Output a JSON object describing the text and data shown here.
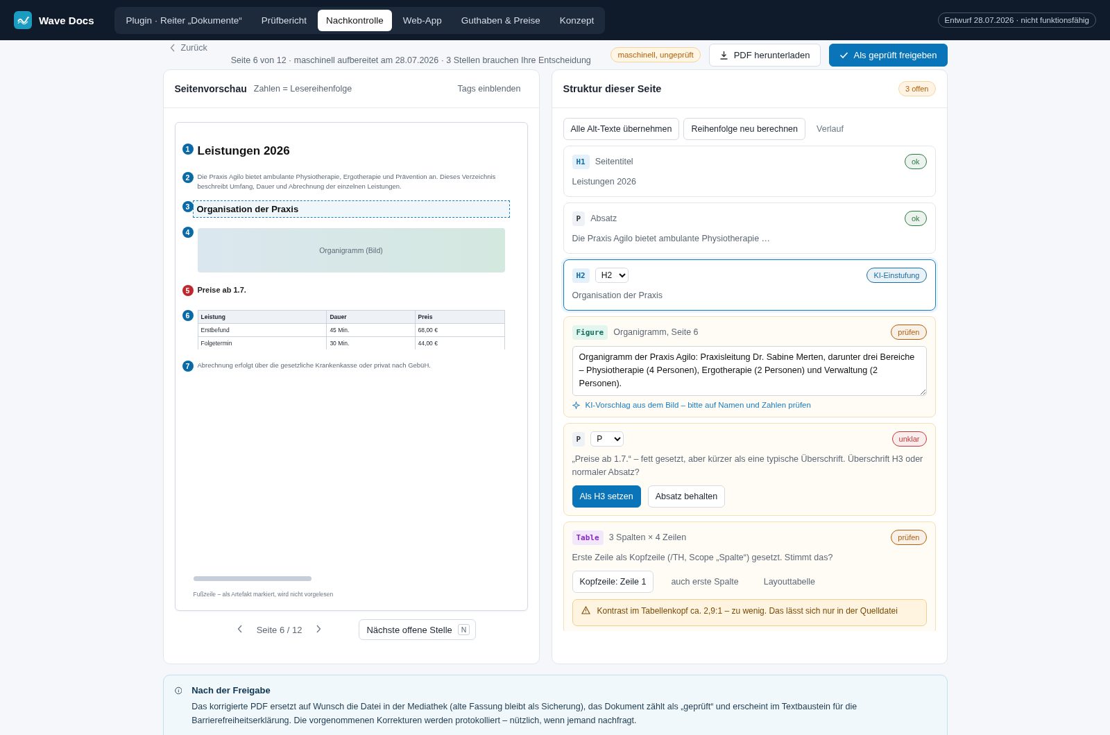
{
  "app": {
    "name": "Wave Docs"
  },
  "nav": [
    {
      "label": "Plugin · Reiter „Dokumente“",
      "selected": false
    },
    {
      "label": "Prüfbericht",
      "selected": false
    },
    {
      "label": "Nachkontrolle",
      "selected": true
    },
    {
      "label": "Web-App",
      "selected": false
    },
    {
      "label": "Guthaben & Preise",
      "selected": false
    },
    {
      "label": "Konzept",
      "selected": false
    }
  ],
  "draft_badge": "Entwurf 28.07.2026 · nicht funktionsfähig",
  "back_link": "Zurück",
  "subtitle": "Seite 6 von 12 · maschinell aufbereitet am 28.07.2026 · 3 Stellen brauchen Ihre Entscheidung",
  "status_badge": "maschinell, ungeprüft",
  "actions": [
    {
      "label": "PDF herunterladen",
      "kind": "download"
    },
    {
      "label": "Als geprüft freigeben",
      "kind": "primary"
    }
  ],
  "preview": {
    "title": "Seitenvorschau",
    "hint": "Zahlen = Lesereihenfolge",
    "toggle": "Tags einblenden",
    "blocks": [
      {
        "kind": "h1",
        "number": "1",
        "text": "Leistungen 2026",
        "flagged": false,
        "selected": false
      },
      {
        "kind": "p",
        "number": "2",
        "text": "Die Praxis Agilo bietet ambulante Physiotherapie, Ergotherapie und Prävention an. Dieses Verzeichnis beschreibt Umfang, Dauer und Abrechnung der einzelnen Leistungen.",
        "flagged": false,
        "selected": false
      },
      {
        "kind": "h2",
        "number": "3",
        "text": "Organisation der Praxis",
        "flagged": false,
        "selected": true
      },
      {
        "kind": "figure",
        "number": "4",
        "text": "Organigramm (Bild)",
        "flagged": false,
        "selected": false
      },
      {
        "kind": "bold",
        "number": "5",
        "text": "Preise ab 1.7.",
        "flagged": true,
        "selected": false
      },
      {
        "kind": "table",
        "number": "6",
        "columns": [
          "Leistung",
          "Dauer",
          "Preis"
        ],
        "rows": [
          [
            "Erstbefund",
            "45 Min.",
            "68,00 €"
          ],
          [
            "Folgetermin",
            "30 Min.",
            "44,00 €"
          ]
        ],
        "flagged": false,
        "selected": false
      },
      {
        "kind": "p",
        "number": "7",
        "text": "Abrechnung erfolgt über die gesetzliche Krankenkasse oder privat nach GebüH.",
        "flagged": false,
        "selected": false
      }
    ],
    "footer": "Fußzeile – als Artefakt markiert, wird nicht vorgelesen",
    "pager": "Seite 6 / 12",
    "next_button": {
      "label": "Nächste offene Stelle",
      "key": "N"
    }
  },
  "structure": {
    "title": "Struktur dieser Seite",
    "open_count": "3 offen",
    "tools": [
      {
        "label": "Alle Alt-Texte übernehmen",
        "kind": "button"
      },
      {
        "label": "Reihenfolge neu berechnen",
        "kind": "button"
      },
      {
        "label": "Verlauf",
        "kind": "link"
      }
    ],
    "items": [
      {
        "kind": "heading",
        "tag": "H1",
        "label": "Seitentitel",
        "status": "ok",
        "color": "#2b7a43",
        "flagged": false,
        "text": "Leistungen 2026",
        "selected": false
      },
      {
        "kind": "paragraph",
        "tag": "P",
        "label": "Absatz",
        "status": "ok",
        "color": "#2b7a43",
        "flagged": false,
        "text": "Die Praxis Agilo bietet ambulante Physiotherapie …",
        "selected": false
      },
      {
        "kind": "heading",
        "tag": "H2",
        "select": "H2",
        "status": "KI-Einstufung",
        "color": "#1b6ea3",
        "flagged": false,
        "text": "Organisation der Praxis",
        "selected": true
      },
      {
        "kind": "figure",
        "tag": "Figure",
        "label": "Organigramm, Seite 6",
        "status": "prüfen",
        "color": "#b45f06",
        "flagged": true,
        "textarea": "Organigramm der Praxis Agilo: Praxisleitung Dr. Sabine Merten, darunter drei Bereiche – Physiotherapie (4 Personen), Ergotherapie (2 Personen) und Verwaltung (2 Personen).",
        "hint": "KI-Vorschlag aus dem Bild – bitte auf Namen und Zahlen prüfen",
        "selected": false
      },
      {
        "kind": "paragraph",
        "tag": "P",
        "select": "P",
        "status": "unklar",
        "color": "#c23a3a",
        "flagged": true,
        "text": "„Preise ab 1.7.“ – fett gesetzt, aber kürzer als eine typische Überschrift. Überschrift H3 oder normaler Absatz?",
        "buttons": [
          {
            "label": "Als H3 setzen",
            "kind": "primary"
          },
          {
            "label": "Absatz behalten",
            "kind": "secondary"
          }
        ],
        "selected": false
      },
      {
        "kind": "table",
        "tag": "Table",
        "label": "3 Spalten × 4 Zeilen",
        "status": "prüfen",
        "color": "#b45f06",
        "flagged": true,
        "text": "Erste Zeile als Kopfzeile (/TH, Scope „Spalte“) gesetzt. Stimmt das?",
        "options": [
          {
            "label": "Kopfzeile: Zeile 1",
            "selected": true
          },
          {
            "label": "auch erste Spalte",
            "selected": false
          },
          {
            "label": "Layouttabelle",
            "selected": false
          }
        ],
        "warning": "Kontrast im Tabellenkopf ca. 2,9:1 – zu wenig. Das lässt sich nur in der Quelldatei",
        "selected": false
      }
    ]
  },
  "info": {
    "title": "Nach der Freigabe",
    "text": "Das korrigierte PDF ersetzt auf Wunsch die Datei in der Mediathek (alte Fassung bleibt als Sicherung), das Dokument zählt als „geprüft“ und erscheint im Textbaustein für die Barrierefreiheitserklärung. Die vorgenommenen Korrekturen werden protokolliert – nützlich, wenn jemand nachfragt."
  }
}
